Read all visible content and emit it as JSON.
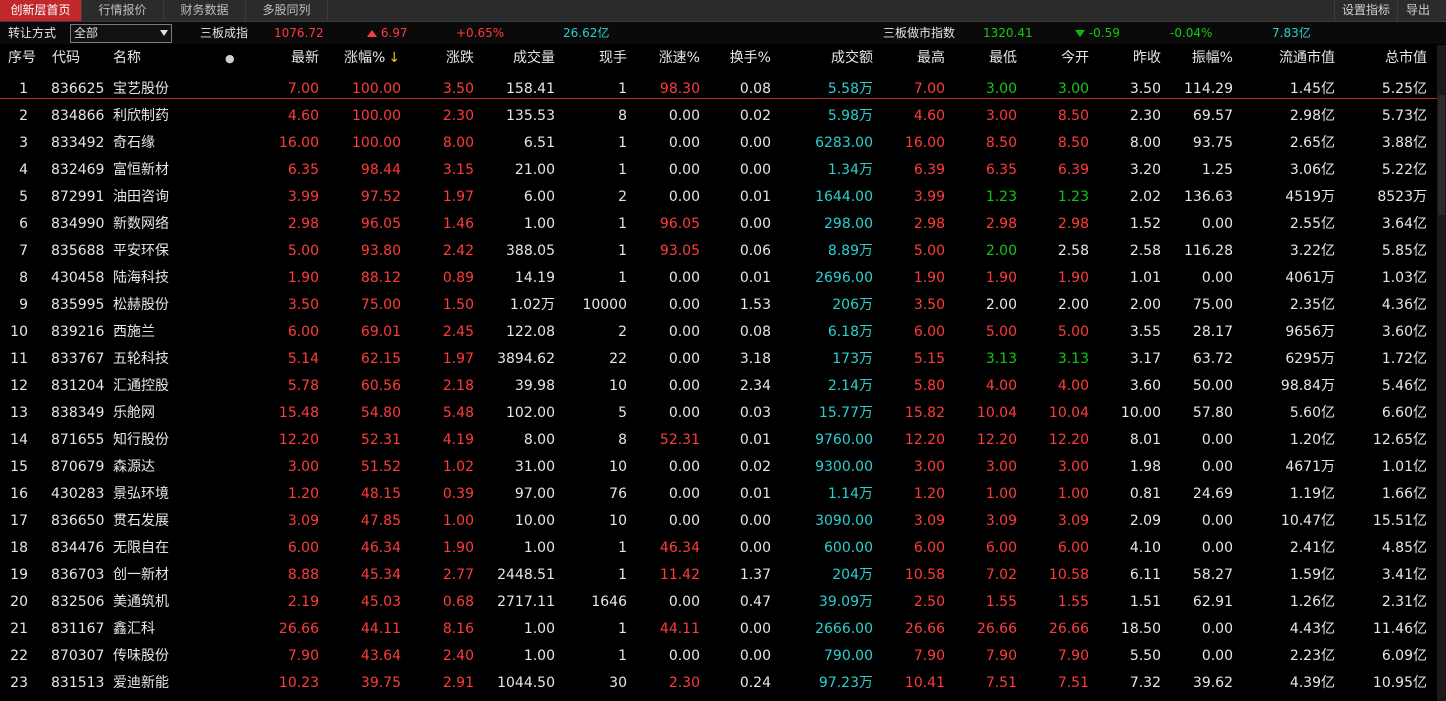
{
  "tabs": [
    {
      "label": "创新层首页",
      "active": true
    },
    {
      "label": "行情报价",
      "active": false
    },
    {
      "label": "财务数据",
      "active": false
    },
    {
      "label": "多股同列",
      "active": false
    }
  ],
  "toolbar": {
    "settings_label": "设置指标",
    "export_label": "导出"
  },
  "subbar": {
    "transfer_label": "转让方式",
    "transfer_value": "全部",
    "index1_name": "三板成指",
    "index1_value": "1076.72",
    "index1_change": "6.97",
    "index1_pct": "+0.65%",
    "index1_amount": "26.62亿",
    "index2_name": "三板做市指数",
    "index2_value": "1320.41",
    "index2_change": "-0.59",
    "index2_pct": "-0.04%",
    "index2_amount": "7.83亿"
  },
  "columns": [
    "序号",
    "代码",
    "名称",
    "●",
    "最新",
    "涨幅%",
    "涨跌",
    "成交量",
    "现手",
    "涨速%",
    "换手%",
    "成交额",
    "最高",
    "最低",
    "今开",
    "昨收",
    "振幅%",
    "流通市值",
    "总市值"
  ],
  "sort_arrow": "↓",
  "colors": {
    "up": "#ff3b3b",
    "down": "#14c814",
    "neutral": "#e6e6e6",
    "amount": "#2ad0d0",
    "active_tab": "#c0282c"
  },
  "rows": [
    {
      "no": "1",
      "code": "836625",
      "name": "宝艺股份",
      "last": "7.00",
      "pct": "100.00",
      "chg": "3.50",
      "vol": "158.41",
      "hand": "1",
      "speed": "98.30",
      "turn": "0.08",
      "amt": "5.58万",
      "high": "7.00",
      "low": "3.00",
      "open": "3.00",
      "prev": "3.50",
      "amp": "114.29",
      "fmv": "1.45亿",
      "tmv": "5.25亿",
      "c": {
        "high": "red",
        "low": "green",
        "open": "green",
        "speed": "red"
      }
    },
    {
      "no": "2",
      "code": "834866",
      "name": "利欣制药",
      "last": "4.60",
      "pct": "100.00",
      "chg": "2.30",
      "vol": "135.53",
      "hand": "8",
      "speed": "0.00",
      "turn": "0.02",
      "amt": "5.98万",
      "high": "4.60",
      "low": "3.00",
      "open": "8.50",
      "prev": "2.30",
      "amp": "69.57",
      "fmv": "2.98亿",
      "tmv": "5.73亿",
      "c": {
        "high": "red",
        "low": "red",
        "open": "red",
        "speed": "white"
      }
    },
    {
      "no": "3",
      "code": "833492",
      "name": "奇石缘",
      "last": "16.00",
      "pct": "100.00",
      "chg": "8.00",
      "vol": "6.51",
      "hand": "1",
      "speed": "0.00",
      "turn": "0.00",
      "amt": "6283.00",
      "high": "16.00",
      "low": "8.50",
      "open": "8.50",
      "prev": "8.00",
      "amp": "93.75",
      "fmv": "2.65亿",
      "tmv": "3.88亿",
      "c": {
        "high": "red",
        "low": "red",
        "open": "red",
        "speed": "white"
      }
    },
    {
      "no": "4",
      "code": "832469",
      "name": "富恒新材",
      "last": "6.35",
      "pct": "98.44",
      "chg": "3.15",
      "vol": "21.00",
      "hand": "1",
      "speed": "0.00",
      "turn": "0.00",
      "amt": "1.34万",
      "high": "6.39",
      "low": "6.35",
      "open": "6.39",
      "prev": "3.20",
      "amp": "1.25",
      "fmv": "3.06亿",
      "tmv": "5.22亿",
      "c": {
        "high": "red",
        "low": "red",
        "open": "red",
        "speed": "white"
      }
    },
    {
      "no": "5",
      "code": "872991",
      "name": "油田咨询",
      "last": "3.99",
      "pct": "97.52",
      "chg": "1.97",
      "vol": "6.00",
      "hand": "2",
      "speed": "0.00",
      "turn": "0.01",
      "amt": "1644.00",
      "high": "3.99",
      "low": "1.23",
      "open": "1.23",
      "prev": "2.02",
      "amp": "136.63",
      "fmv": "4519万",
      "tmv": "8523万",
      "c": {
        "high": "red",
        "low": "green",
        "open": "green",
        "speed": "white"
      }
    },
    {
      "no": "6",
      "code": "834990",
      "name": "新数网络",
      "last": "2.98",
      "pct": "96.05",
      "chg": "1.46",
      "vol": "1.00",
      "hand": "1",
      "speed": "96.05",
      "turn": "0.00",
      "amt": "298.00",
      "high": "2.98",
      "low": "2.98",
      "open": "2.98",
      "prev": "1.52",
      "amp": "0.00",
      "fmv": "2.55亿",
      "tmv": "3.64亿",
      "c": {
        "high": "red",
        "low": "red",
        "open": "red",
        "speed": "red"
      }
    },
    {
      "no": "7",
      "code": "835688",
      "name": "平安环保",
      "last": "5.00",
      "pct": "93.80",
      "chg": "2.42",
      "vol": "388.05",
      "hand": "1",
      "speed": "93.05",
      "turn": "0.06",
      "amt": "8.89万",
      "high": "5.00",
      "low": "2.00",
      "open": "2.58",
      "prev": "2.58",
      "amp": "116.28",
      "fmv": "3.22亿",
      "tmv": "5.85亿",
      "c": {
        "high": "red",
        "low": "green",
        "open": "white",
        "speed": "red"
      }
    },
    {
      "no": "8",
      "code": "430458",
      "name": "陆海科技",
      "last": "1.90",
      "pct": "88.12",
      "chg": "0.89",
      "vol": "14.19",
      "hand": "1",
      "speed": "0.00",
      "turn": "0.01",
      "amt": "2696.00",
      "high": "1.90",
      "low": "1.90",
      "open": "1.90",
      "prev": "1.01",
      "amp": "0.00",
      "fmv": "4061万",
      "tmv": "1.03亿",
      "c": {
        "high": "red",
        "low": "red",
        "open": "red",
        "speed": "white"
      }
    },
    {
      "no": "9",
      "code": "835995",
      "name": "松赫股份",
      "last": "3.50",
      "pct": "75.00",
      "chg": "1.50",
      "vol": "1.02万",
      "hand": "10000",
      "speed": "0.00",
      "turn": "1.53",
      "amt": "206万",
      "high": "3.50",
      "low": "2.00",
      "open": "2.00",
      "prev": "2.00",
      "amp": "75.00",
      "fmv": "2.35亿",
      "tmv": "4.36亿",
      "c": {
        "high": "red",
        "low": "white",
        "open": "white",
        "speed": "white"
      }
    },
    {
      "no": "10",
      "code": "839216",
      "name": "西施兰",
      "last": "6.00",
      "pct": "69.01",
      "chg": "2.45",
      "vol": "122.08",
      "hand": "2",
      "speed": "0.00",
      "turn": "0.08",
      "amt": "6.18万",
      "high": "6.00",
      "low": "5.00",
      "open": "5.00",
      "prev": "3.55",
      "amp": "28.17",
      "fmv": "9656万",
      "tmv": "3.60亿",
      "c": {
        "high": "red",
        "low": "red",
        "open": "red",
        "speed": "white"
      }
    },
    {
      "no": "11",
      "code": "833767",
      "name": "五轮科技",
      "last": "5.14",
      "pct": "62.15",
      "chg": "1.97",
      "vol": "3894.62",
      "hand": "22",
      "speed": "0.00",
      "turn": "3.18",
      "amt": "173万",
      "high": "5.15",
      "low": "3.13",
      "open": "3.13",
      "prev": "3.17",
      "amp": "63.72",
      "fmv": "6295万",
      "tmv": "1.72亿",
      "c": {
        "high": "red",
        "low": "green",
        "open": "green",
        "speed": "white"
      }
    },
    {
      "no": "12",
      "code": "831204",
      "name": "汇通控股",
      "last": "5.78",
      "pct": "60.56",
      "chg": "2.18",
      "vol": "39.98",
      "hand": "10",
      "speed": "0.00",
      "turn": "2.34",
      "amt": "2.14万",
      "high": "5.80",
      "low": "4.00",
      "open": "4.00",
      "prev": "3.60",
      "amp": "50.00",
      "fmv": "98.84万",
      "tmv": "5.46亿",
      "c": {
        "high": "red",
        "low": "red",
        "open": "red",
        "speed": "white"
      }
    },
    {
      "no": "13",
      "code": "838349",
      "name": "乐舱网",
      "last": "15.48",
      "pct": "54.80",
      "chg": "5.48",
      "vol": "102.00",
      "hand": "5",
      "speed": "0.00",
      "turn": "0.03",
      "amt": "15.77万",
      "high": "15.82",
      "low": "10.04",
      "open": "10.04",
      "prev": "10.00",
      "amp": "57.80",
      "fmv": "5.60亿",
      "tmv": "6.60亿",
      "c": {
        "high": "red",
        "low": "red",
        "open": "red",
        "speed": "white"
      }
    },
    {
      "no": "14",
      "code": "871655",
      "name": "知行股份",
      "last": "12.20",
      "pct": "52.31",
      "chg": "4.19",
      "vol": "8.00",
      "hand": "8",
      "speed": "52.31",
      "turn": "0.01",
      "amt": "9760.00",
      "high": "12.20",
      "low": "12.20",
      "open": "12.20",
      "prev": "8.01",
      "amp": "0.00",
      "fmv": "1.20亿",
      "tmv": "12.65亿",
      "c": {
        "high": "red",
        "low": "red",
        "open": "red",
        "speed": "red"
      }
    },
    {
      "no": "15",
      "code": "870679",
      "name": "森源达",
      "last": "3.00",
      "pct": "51.52",
      "chg": "1.02",
      "vol": "31.00",
      "hand": "10",
      "speed": "0.00",
      "turn": "0.02",
      "amt": "9300.00",
      "high": "3.00",
      "low": "3.00",
      "open": "3.00",
      "prev": "1.98",
      "amp": "0.00",
      "fmv": "4671万",
      "tmv": "1.01亿",
      "c": {
        "high": "red",
        "low": "red",
        "open": "red",
        "speed": "white"
      }
    },
    {
      "no": "16",
      "code": "430283",
      "name": "景弘环境",
      "last": "1.20",
      "pct": "48.15",
      "chg": "0.39",
      "vol": "97.00",
      "hand": "76",
      "speed": "0.00",
      "turn": "0.01",
      "amt": "1.14万",
      "high": "1.20",
      "low": "1.00",
      "open": "1.00",
      "prev": "0.81",
      "amp": "24.69",
      "fmv": "1.19亿",
      "tmv": "1.66亿",
      "c": {
        "high": "red",
        "low": "red",
        "open": "red",
        "speed": "white"
      }
    },
    {
      "no": "17",
      "code": "836650",
      "name": "贯石发展",
      "last": "3.09",
      "pct": "47.85",
      "chg": "1.00",
      "vol": "10.00",
      "hand": "10",
      "speed": "0.00",
      "turn": "0.00",
      "amt": "3090.00",
      "high": "3.09",
      "low": "3.09",
      "open": "3.09",
      "prev": "2.09",
      "amp": "0.00",
      "fmv": "10.47亿",
      "tmv": "15.51亿",
      "c": {
        "high": "red",
        "low": "red",
        "open": "red",
        "speed": "white"
      }
    },
    {
      "no": "18",
      "code": "834476",
      "name": "无限自在",
      "last": "6.00",
      "pct": "46.34",
      "chg": "1.90",
      "vol": "1.00",
      "hand": "1",
      "speed": "46.34",
      "turn": "0.00",
      "amt": "600.00",
      "high": "6.00",
      "low": "6.00",
      "open": "6.00",
      "prev": "4.10",
      "amp": "0.00",
      "fmv": "2.41亿",
      "tmv": "4.85亿",
      "c": {
        "high": "red",
        "low": "red",
        "open": "red",
        "speed": "red"
      }
    },
    {
      "no": "19",
      "code": "836703",
      "name": "创一新材",
      "last": "8.88",
      "pct": "45.34",
      "chg": "2.77",
      "vol": "2448.51",
      "hand": "1",
      "speed": "11.42",
      "turn": "1.37",
      "amt": "204万",
      "high": "10.58",
      "low": "7.02",
      "open": "10.58",
      "prev": "6.11",
      "amp": "58.27",
      "fmv": "1.59亿",
      "tmv": "3.41亿",
      "c": {
        "high": "red",
        "low": "red",
        "open": "red",
        "speed": "red"
      }
    },
    {
      "no": "20",
      "code": "832506",
      "name": "美通筑机",
      "last": "2.19",
      "pct": "45.03",
      "chg": "0.68",
      "vol": "2717.11",
      "hand": "1646",
      "speed": "0.00",
      "turn": "0.47",
      "amt": "39.09万",
      "high": "2.50",
      "low": "1.55",
      "open": "1.55",
      "prev": "1.51",
      "amp": "62.91",
      "fmv": "1.26亿",
      "tmv": "2.31亿",
      "c": {
        "high": "red",
        "low": "red",
        "open": "red",
        "speed": "white"
      }
    },
    {
      "no": "21",
      "code": "831167",
      "name": "鑫汇科",
      "last": "26.66",
      "pct": "44.11",
      "chg": "8.16",
      "vol": "1.00",
      "hand": "1",
      "speed": "44.11",
      "turn": "0.00",
      "amt": "2666.00",
      "high": "26.66",
      "low": "26.66",
      "open": "26.66",
      "prev": "18.50",
      "amp": "0.00",
      "fmv": "4.43亿",
      "tmv": "11.46亿",
      "c": {
        "high": "red",
        "low": "red",
        "open": "red",
        "speed": "red"
      }
    },
    {
      "no": "22",
      "code": "870307",
      "name": "传味股份",
      "last": "7.90",
      "pct": "43.64",
      "chg": "2.40",
      "vol": "1.00",
      "hand": "1",
      "speed": "0.00",
      "turn": "0.00",
      "amt": "790.00",
      "high": "7.90",
      "low": "7.90",
      "open": "7.90",
      "prev": "5.50",
      "amp": "0.00",
      "fmv": "2.23亿",
      "tmv": "6.09亿",
      "c": {
        "high": "red",
        "low": "red",
        "open": "red",
        "speed": "white"
      }
    },
    {
      "no": "23",
      "code": "831513",
      "name": "爱迪新能",
      "last": "10.23",
      "pct": "39.75",
      "chg": "2.91",
      "vol": "1044.50",
      "hand": "30",
      "speed": "2.30",
      "turn": "0.24",
      "amt": "97.23万",
      "high": "10.41",
      "low": "7.51",
      "open": "7.51",
      "prev": "7.32",
      "amp": "39.62",
      "fmv": "4.39亿",
      "tmv": "10.95亿",
      "c": {
        "high": "red",
        "low": "red",
        "open": "red",
        "speed": "red"
      }
    }
  ]
}
